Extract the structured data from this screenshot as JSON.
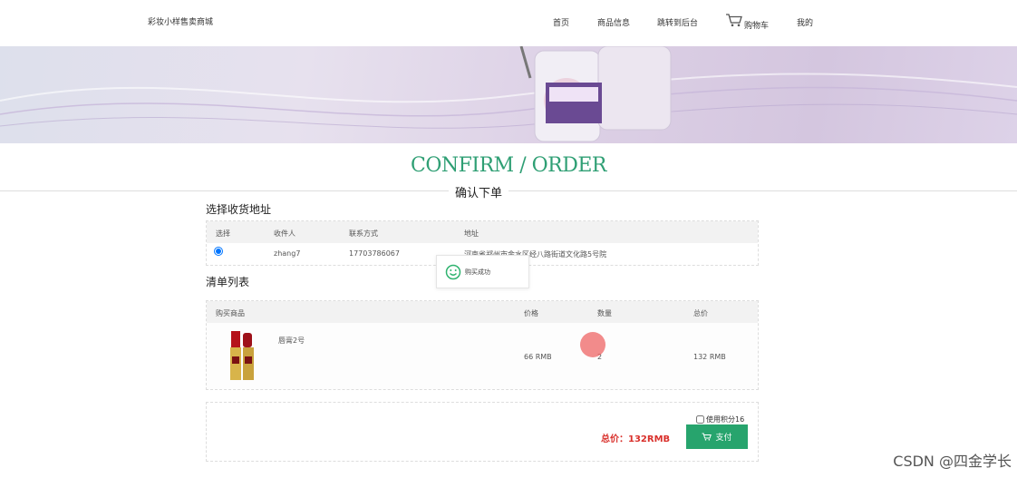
{
  "header": {
    "logo": "彩妆小样售卖商城",
    "nav": [
      "首页",
      "商品信息",
      "跳转到后台",
      "购物车",
      "我的"
    ]
  },
  "page": {
    "title_en": "CONFIRM / ORDER",
    "title_cn": "确认下单"
  },
  "address": {
    "section_title": "选择收货地址",
    "columns": [
      "选择",
      "收件人",
      "联系方式",
      "地址"
    ],
    "rows": [
      {
        "recipient": "zhang7",
        "phone": "17703786067",
        "address": "河南省郑州市金水区经八路街道文化路5号院",
        "selected": true
      }
    ]
  },
  "toast": {
    "text": "购买成功"
  },
  "items": {
    "section_title": "清单列表",
    "columns": [
      "购买商品",
      "价格",
      "数量",
      "总价"
    ],
    "rows": [
      {
        "name": "唇膏2号",
        "price": "66 RMB",
        "qty": "2",
        "total": "132 RMB"
      }
    ]
  },
  "summary": {
    "points_label": "使用积分16",
    "total_label": "总价：",
    "total_value": "132RMB",
    "pay_label": "支付"
  },
  "watermark": "CSDN @四金学长",
  "colors": {
    "accent": "#27a46d",
    "title": "#2f9f74",
    "total": "#d9302b"
  }
}
